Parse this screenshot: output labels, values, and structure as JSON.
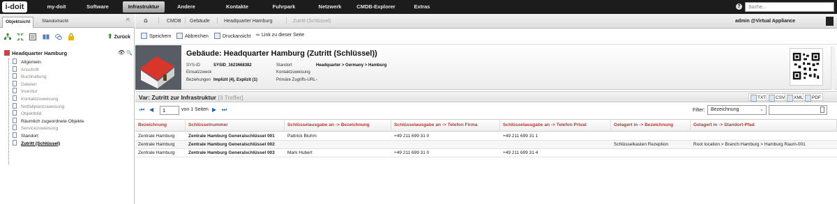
{
  "topbar": {
    "logo": "i-doit",
    "nav": [
      {
        "label": "my-doit"
      },
      {
        "label": "Software"
      },
      {
        "label": "Infrastruktur",
        "active": true
      },
      {
        "label": "Andere"
      },
      {
        "label": "Kontakte"
      },
      {
        "label": "Fuhrpark"
      },
      {
        "label": "Netzwerk"
      },
      {
        "label": "CMDB-Explorer"
      },
      {
        "label": "Extras"
      }
    ],
    "help": "?",
    "search_placeholder": "Suche..."
  },
  "left": {
    "tabs": [
      "Objektsicht",
      "Standortsicht"
    ],
    "back_label": "Zurück",
    "tree_root": "Headquarter Hamburg",
    "tree_items": [
      {
        "label": "Allgemein",
        "style": "normal"
      },
      {
        "label": "Anschrift",
        "style": "grey"
      },
      {
        "label": "Buchhaltung",
        "style": "grey"
      },
      {
        "label": "Dateien",
        "style": "grey"
      },
      {
        "label": "Inventur",
        "style": "grey"
      },
      {
        "label": "Kontaktzuweisung",
        "style": "grey"
      },
      {
        "label": "Notfallplanzuweisung",
        "style": "grey"
      },
      {
        "label": "Objektbild",
        "style": "grey"
      },
      {
        "label": "Räumlich zugeordnete Objekte",
        "style": "normal"
      },
      {
        "label": "Servicezuweisung",
        "style": "grey"
      },
      {
        "label": "Standort",
        "style": "normal"
      },
      {
        "label": "Zutritt (Schlüssel)",
        "style": "current"
      }
    ]
  },
  "breadcrumb": [
    "CMDB",
    "Gebäude",
    "Headquarter Hamburg",
    "Zutritt (Schlüssel)"
  ],
  "user": "admin @Virtual Appliance",
  "actions": [
    "Speichern",
    "Abbrechen",
    "Druckansicht",
    "Link zu dieser Seite"
  ],
  "header": {
    "title": "Gebäude: Headquarter Hamburg (Zutritt (Schlüssel))",
    "fields": {
      "sysid_label": "SYS-ID",
      "sysid_value": "SYSID_1623668382",
      "einsatz_label": "Einsatzzweck",
      "beziehungen_label": "Beziehungen",
      "beziehungen_value": "Implizit (4), Explizit (1)",
      "standort_label": "Standort",
      "standort_value": "Headquarter > Germany > Hamburg",
      "kontakt_label": "Kontaktzuweisung",
      "url_label": "Primäre Zugriffs-URL",
      "url_value": "-"
    }
  },
  "list": {
    "title": "Var: Zutritt zur Infrastruktur",
    "count": "[3 Treffer]",
    "exports": [
      "TXT",
      "CSV",
      "XML",
      "PDF"
    ],
    "page": "1",
    "page_of": "von 1 Seiten",
    "filter_label": "Filter:",
    "filter_value": "Bezeichnung",
    "columns": [
      "Bezeichnung",
      "Schlüsselnummer",
      "Schlüsselausgabe an -> Bezeichnung",
      "Schlüsselausgabe an -> Telefon Firma",
      "Schlüsselausgabe an -> Telefon Privat",
      "Gelagert in -> Bezeichnung",
      "Gelagert in -> Standort-Pfad"
    ],
    "rows": [
      [
        "Zentrale Hamburg",
        "Zentrale Hamburg Generalschlüssel 001",
        "Pattrick Bluhm",
        "+49 211 699 31 0",
        "+49 211 699 31 1",
        "",
        ""
      ],
      [
        "Zentrale Hamburg",
        "Zentrale Hamburg Generalschlüssel 002",
        "",
        "",
        "",
        "Schlüsselkasten Rezeption",
        "Root location > Branch Hamburg > Hamburg Raum-001"
      ],
      [
        "Zentrale Hamburg",
        "Zentrale Hamburg Generalschlüssel 003",
        "Mark Hubert",
        "+49 211 699 31 0",
        "+49 211 699 31 4",
        "",
        ""
      ]
    ]
  }
}
